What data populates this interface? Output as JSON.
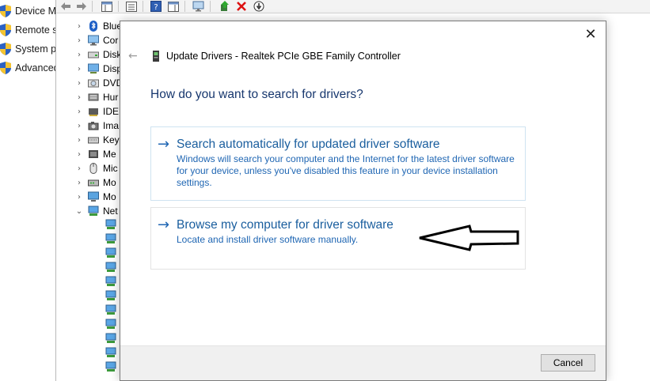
{
  "left_panel": {
    "items": [
      {
        "label": "Device M",
        "icon": "shield-icon"
      },
      {
        "label": "Remote s",
        "icon": "shield-icon"
      },
      {
        "label": "System pr",
        "icon": "shield-icon"
      },
      {
        "label": "Advanced",
        "icon": "shield-icon"
      }
    ]
  },
  "device_tree": {
    "rows": [
      {
        "label": "Blue",
        "icon": "bluetooth-icon",
        "chevron": "›"
      },
      {
        "label": "Cor",
        "icon": "computer-icon",
        "chevron": "›"
      },
      {
        "label": "Disk",
        "icon": "disk-drive-icon",
        "chevron": "›"
      },
      {
        "label": "Disp",
        "icon": "display-adapter-icon",
        "chevron": "›"
      },
      {
        "label": "DVD",
        "icon": "dvd-drive-icon",
        "chevron": "›"
      },
      {
        "label": "Hur",
        "icon": "hid-icon",
        "chevron": "›"
      },
      {
        "label": "IDE",
        "icon": "ide-controller-icon",
        "chevron": "›"
      },
      {
        "label": "Ima",
        "icon": "imaging-device-icon",
        "chevron": "›"
      },
      {
        "label": "Key",
        "icon": "keyboard-icon",
        "chevron": "›"
      },
      {
        "label": "Me",
        "icon": "memory-device-icon",
        "chevron": "›"
      },
      {
        "label": "Mic",
        "icon": "mouse-icon",
        "chevron": "›"
      },
      {
        "label": "Mo",
        "icon": "modem-icon",
        "chevron": "›"
      },
      {
        "label": "Mo",
        "icon": "monitor-icon",
        "chevron": "›"
      },
      {
        "label": "Net",
        "icon": "network-adapter-icon",
        "chevron": "⌄"
      }
    ],
    "network_children_count": 11
  },
  "dialog": {
    "title": "Update Drivers - Realtek PCIe GBE Family Controller",
    "question": "How do you want to search for drivers?",
    "close_glyph": "✕",
    "back_glyph": "←",
    "options": [
      {
        "arrow": "→",
        "title": "Search automatically for updated driver software",
        "description": "Windows will search your computer and the Internet for the latest driver software for your device, unless you've disabled this feature in your device installation settings."
      },
      {
        "arrow": "→",
        "title": "Browse my computer for driver software",
        "description": "Locate and install driver software manually."
      }
    ],
    "cancel_label": "Cancel"
  },
  "colors": {
    "accent": "#1a5e9e",
    "question": "#17376e",
    "link_text": "#1f66b3"
  }
}
